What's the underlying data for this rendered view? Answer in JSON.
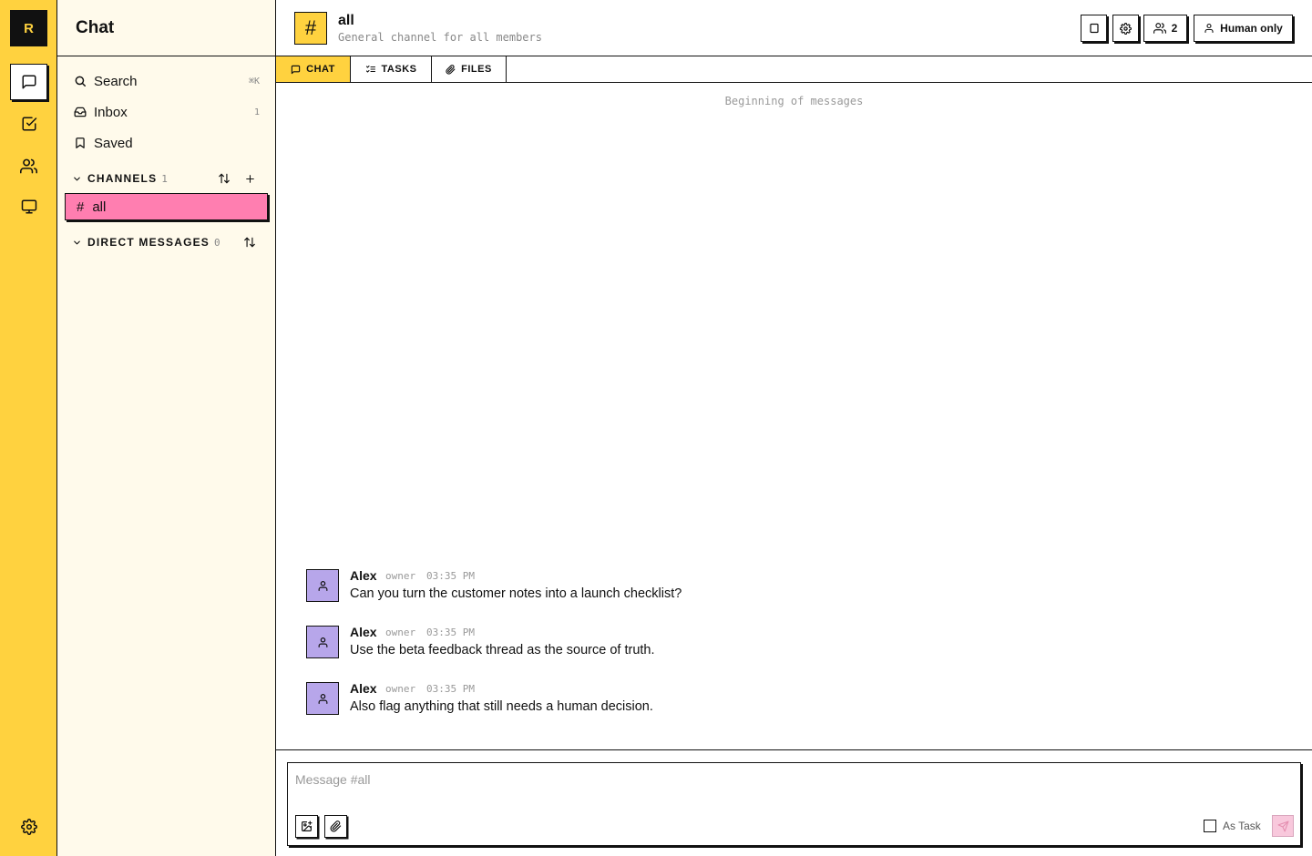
{
  "app": {
    "logo_letter": "R",
    "accent_color": "#ffd23f",
    "active_channel_color": "#ff7eb0",
    "avatar_color": "#b7a6ea"
  },
  "rail": {
    "items": [
      {
        "name": "chat",
        "icon": "message-square-icon",
        "active": true
      },
      {
        "name": "tasks",
        "icon": "check-square-icon",
        "active": false
      },
      {
        "name": "members",
        "icon": "users-icon",
        "active": false
      },
      {
        "name": "computer",
        "icon": "monitor-icon",
        "active": false
      }
    ],
    "settings_icon": "gear-icon"
  },
  "sidebar": {
    "title": "Chat",
    "nav": {
      "search": {
        "label": "Search",
        "hint": "⌘K",
        "icon": "search-icon"
      },
      "inbox": {
        "label": "Inbox",
        "hint": "1",
        "icon": "inbox-icon"
      },
      "saved": {
        "label": "Saved",
        "icon": "bookmark-icon"
      }
    },
    "channels": {
      "label": "CHANNELS",
      "count": "1",
      "items": [
        {
          "name": "all",
          "prefix": "#"
        }
      ]
    },
    "direct_messages": {
      "label": "DIRECT MESSAGES",
      "count": "0"
    }
  },
  "channel": {
    "icon_glyph": "#",
    "name": "all",
    "description": "General channel for all members",
    "member_count": "2",
    "mode_label": "Human only"
  },
  "tabs": [
    {
      "label": "CHAT",
      "icon": "message-square-icon",
      "active": true
    },
    {
      "label": "TASKS",
      "icon": "list-checks-icon",
      "active": false
    },
    {
      "label": "FILES",
      "icon": "paperclip-icon",
      "active": false
    }
  ],
  "messages": {
    "beginning_text": "Beginning of messages",
    "items": [
      {
        "author": "Alex",
        "role": "owner",
        "time": "03:35 PM",
        "text": "Can you turn the customer notes into a launch checklist?"
      },
      {
        "author": "Alex",
        "role": "owner",
        "time": "03:35 PM",
        "text": "Use the beta feedback thread as the source of truth."
      },
      {
        "author": "Alex",
        "role": "owner",
        "time": "03:35 PM",
        "text": "Also flag anything that still needs a human decision."
      }
    ]
  },
  "composer": {
    "placeholder": "Message #all",
    "value": "",
    "as_task_label": "As Task",
    "as_task_checked": false
  }
}
